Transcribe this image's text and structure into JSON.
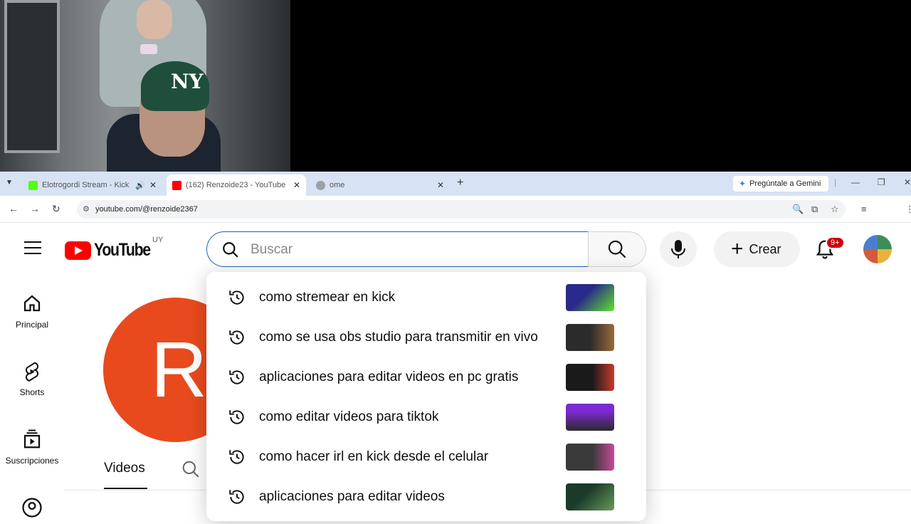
{
  "browser": {
    "tabs": [
      {
        "title": "Elotrogordi Stream - Kick D",
        "favicon_color": "#53fc18",
        "active": false
      },
      {
        "title": "(162) Renzoide23 - YouTube",
        "favicon_color": "#ff0000",
        "active": true
      },
      {
        "title": "ome",
        "favicon_color": "#9aa0a6",
        "active": false
      }
    ],
    "gemini_label": "Pregúntale a Gemini",
    "url": "youtube.com/@renzoide2367"
  },
  "youtube": {
    "logo_text": "YouTube",
    "country_code": "UY",
    "search_placeholder": "Buscar",
    "create_label": "Crear",
    "notif_badge": "9+",
    "guide": [
      {
        "label": "Principal",
        "icon": "home-icon"
      },
      {
        "label": "Shorts",
        "icon": "shorts-icon"
      },
      {
        "label": "Suscripciones",
        "icon": "subscriptions-icon"
      }
    ],
    "channel_initial": "R",
    "tab_videos": "Videos",
    "suggestions": [
      {
        "text": "como stremear en kick",
        "thumb_colors": [
          "#2a2a8a",
          "#5de22a"
        ]
      },
      {
        "text": "como se usa obs studio para transmitir en vivo",
        "thumb_colors": [
          "#2b2b2b",
          "#9a6a3a"
        ]
      },
      {
        "text": "aplicaciones para editar videos en pc gratis",
        "thumb_colors": [
          "#1a1a1a",
          "#c83a2a"
        ]
      },
      {
        "text": "como editar videos para tiktok",
        "thumb_colors": [
          "#7a2ad0",
          "#2a2a2a"
        ]
      },
      {
        "text": "como hacer irl en kick desde el celular",
        "thumb_colors": [
          "#3a3a3a",
          "#c84a9a"
        ]
      },
      {
        "text": "aplicaciones para editar videos",
        "thumb_colors": [
          "#1a3a2a",
          "#6a9a5a"
        ]
      }
    ]
  }
}
